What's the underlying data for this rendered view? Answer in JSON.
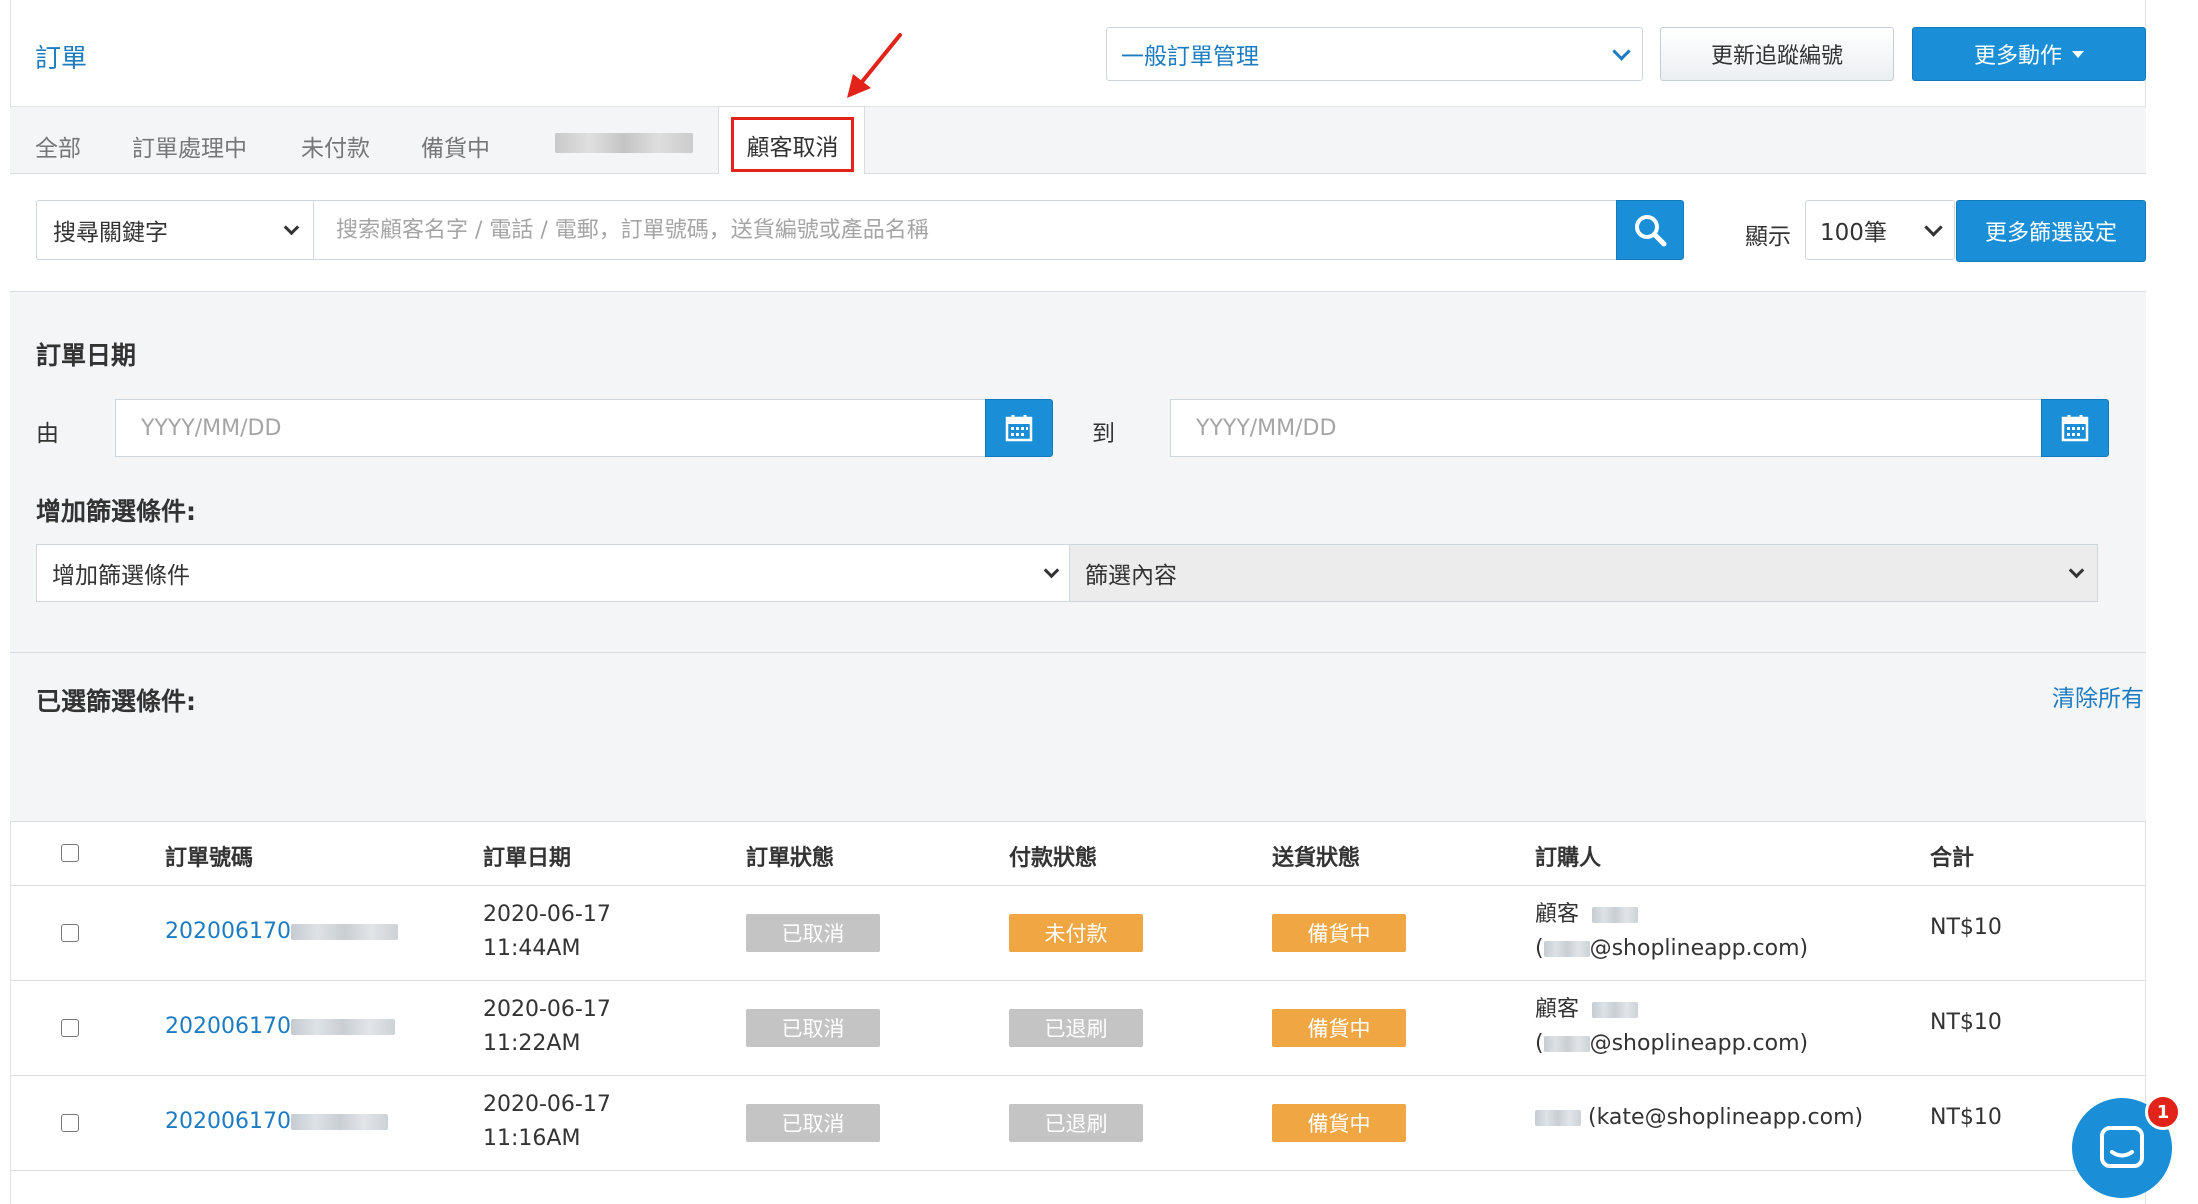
{
  "header": {
    "title": "訂單",
    "order_type": "一般訂單管理",
    "update_tracking": "更新追蹤編號",
    "more_actions": "更多動作"
  },
  "tabs": [
    {
      "label": "全部"
    },
    {
      "label": "訂單處理中"
    },
    {
      "label": "未付款"
    },
    {
      "label": "備貨中"
    },
    {
      "label": "顧客取消",
      "active": true
    }
  ],
  "search": {
    "field_select": "搜尋關鍵字",
    "placeholder": "搜索顧客名字 / 電話 / 電郵，訂單號碼，送貨編號或產品名稱",
    "show_label": "顯示",
    "per_page": "100筆",
    "more_filters": "更多篩選設定"
  },
  "filters": {
    "order_date_title": "訂單日期",
    "from_label": "由",
    "to_label": "到",
    "date_placeholder": "YYYY/MM/DD",
    "add_condition_title": "增加篩選條件:",
    "add_condition_select": "增加篩選條件",
    "condition_content_select": "篩選內容",
    "selected_title": "已選篩選條件:",
    "clear_all": "清除所有"
  },
  "table": {
    "headers": {
      "order_no": "訂單號碼",
      "order_date": "訂單日期",
      "order_status": "訂單狀態",
      "payment_status": "付款狀態",
      "delivery_status": "送貨狀態",
      "customer": "訂購人",
      "total": "合計"
    },
    "rows": [
      {
        "order_no": "202006170",
        "date": "2020-06-17",
        "time": "11:44AM",
        "order_status": "已取消",
        "payment_status": "未付款",
        "delivery_status": "備貨中",
        "customer_line1": "顧客",
        "customer_line2": "@shoplineapp.com)",
        "total": "NT$10"
      },
      {
        "order_no": "202006170",
        "date": "2020-06-17",
        "time": "11:22AM",
        "order_status": "已取消",
        "payment_status": "已退刷",
        "delivery_status": "備貨中",
        "customer_line1": "顧客",
        "customer_line2": "@shoplineapp.com)",
        "total": "NT$10"
      },
      {
        "order_no": "202006170",
        "date": "2020-06-17",
        "time": "11:16AM",
        "order_status": "已取消",
        "payment_status": "已退刷",
        "delivery_status": "備貨中",
        "customer_line1": "(kate@shoplineapp.com)",
        "total": "NT$10"
      }
    ]
  },
  "chat": {
    "badge_count": "1"
  },
  "colors": {
    "primary": "#1a8fd8",
    "link": "#1d7cc1",
    "highlight": "#e2231a",
    "badge_grey": "#c4c4c4",
    "badge_orange": "#f0a642"
  }
}
